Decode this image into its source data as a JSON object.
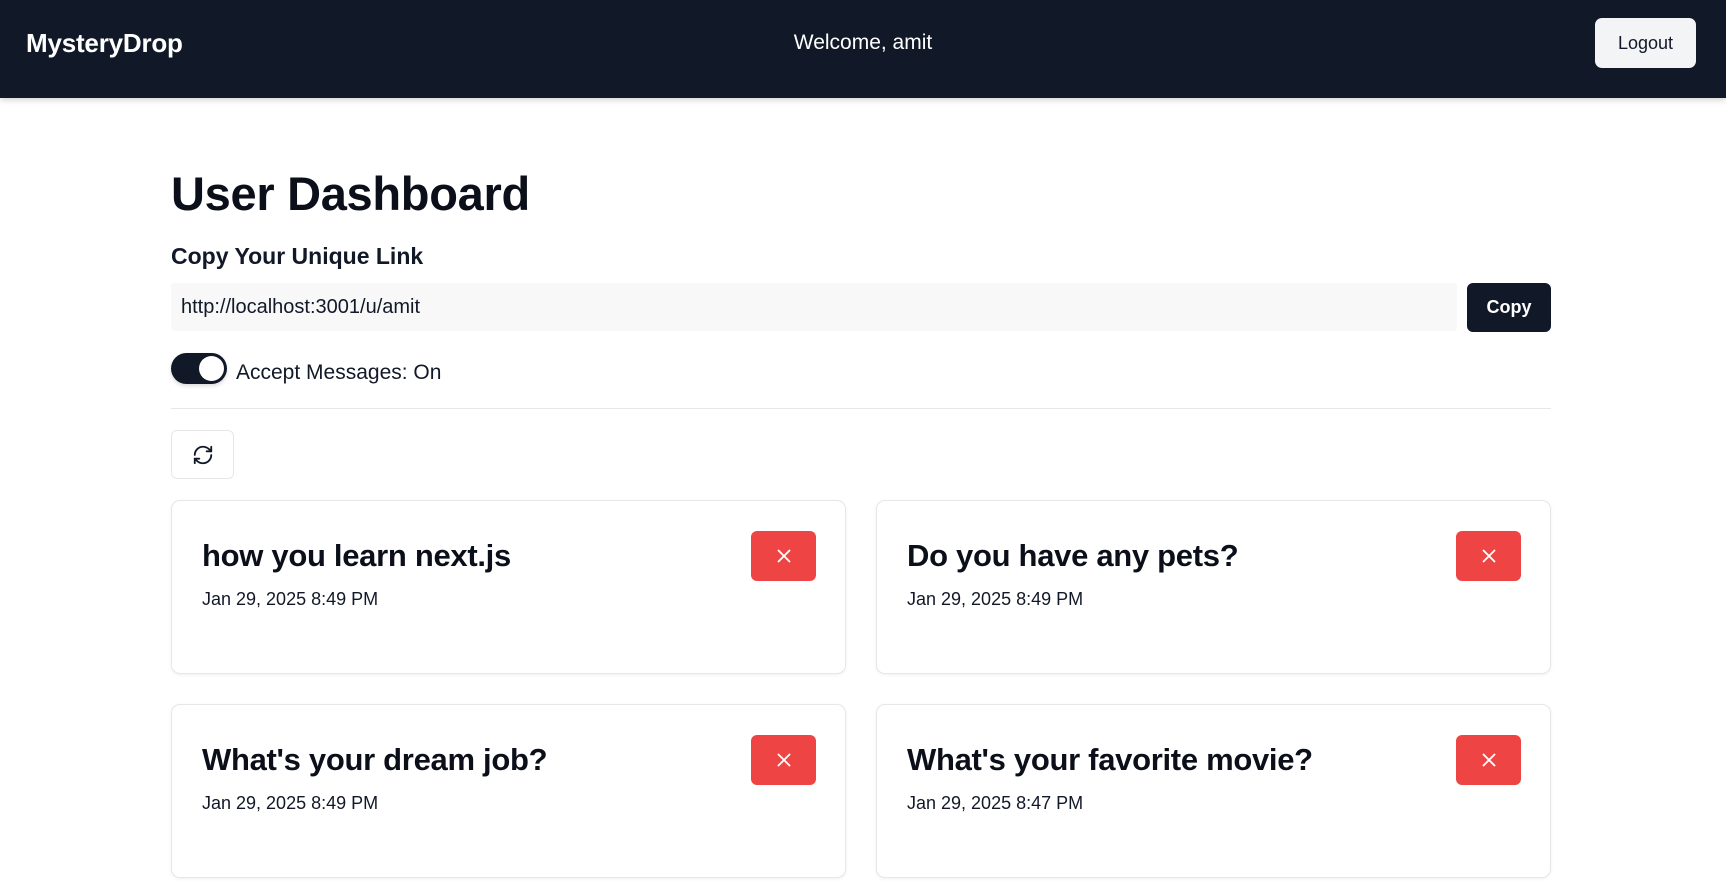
{
  "navbar": {
    "brand": "MysteryDrop",
    "welcome": "Welcome, amit",
    "logout_label": "Logout"
  },
  "dashboard": {
    "title": "User Dashboard",
    "link_section_label": "Copy Your Unique Link",
    "unique_link": "http://localhost:3001/u/amit",
    "copy_label": "Copy",
    "accept_messages_label": "Accept Messages: On",
    "accept_messages_on": true
  },
  "icons": {
    "refresh": "refresh-icon",
    "delete": "x-icon"
  },
  "colors": {
    "navbar_bg": "#111827",
    "primary": "#111827",
    "danger": "#ef4444"
  },
  "messages": [
    {
      "content": "how you learn next.js",
      "date": "Jan 29, 2025 8:49 PM"
    },
    {
      "content": "Do you have any pets?",
      "date": "Jan 29, 2025 8:49 PM"
    },
    {
      "content": "What's your dream job?",
      "date": "Jan 29, 2025 8:49 PM"
    },
    {
      "content": "What's your favorite movie?",
      "date": "Jan 29, 2025 8:47 PM"
    }
  ]
}
